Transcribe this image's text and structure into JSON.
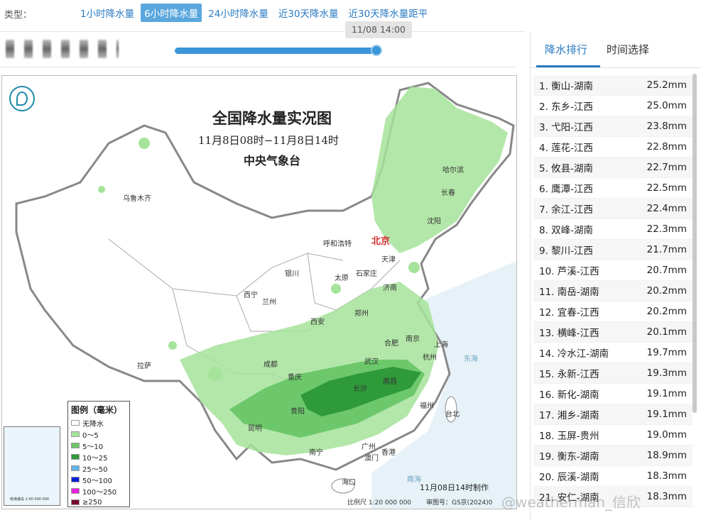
{
  "toolbar": {
    "type_label": "类型：",
    "tabs": [
      "1小时降水量",
      "6小时降水量",
      "24小时降水量",
      "近30天降水量",
      "近30天降水量距平"
    ],
    "active_tab": 1
  },
  "timeline": {
    "tooltip": "11/08 14:00",
    "progress": 1.0
  },
  "map": {
    "title": "全国降水量实况图",
    "subtitle": "11月8日08时−11月8日14时",
    "org": "中央气象台",
    "made": "11月08日14时制作",
    "scale": "比例尺 1:20 000 000",
    "approval": "审图号：GS京(2024)0",
    "capital": "北京",
    "cities": [
      "乌鲁木齐",
      "哈尔滨",
      "长春",
      "沈阳",
      "呼和浩特",
      "天津",
      "银川",
      "太原",
      "石家庄",
      "济南",
      "西宁",
      "兰州",
      "郑州",
      "西安",
      "合肥",
      "南京",
      "上海",
      "武汉",
      "杭州",
      "拉萨",
      "成都",
      "重庆",
      "南昌",
      "长沙",
      "贵阳",
      "福州",
      "台北",
      "昆明",
      "南宁",
      "广州",
      "澳门",
      "香港",
      "海口",
      "东海",
      "南海"
    ],
    "inset_caption": "南海诸岛 1:40 000 000",
    "legend": {
      "title": "图例（毫米）",
      "items": [
        {
          "label": "无降水",
          "color": "#ffffff"
        },
        {
          "label": "0～5",
          "color": "#a6e39a"
        },
        {
          "label": "5～10",
          "color": "#6cc86a"
        },
        {
          "label": "10～25",
          "color": "#2f9a3a"
        },
        {
          "label": "25～50",
          "color": "#62b2ea"
        },
        {
          "label": "50～100",
          "color": "#0b1fd6"
        },
        {
          "label": "100～250",
          "color": "#ea1fe0"
        },
        {
          "label": "≥250",
          "color": "#7a0a2c"
        }
      ]
    }
  },
  "watermark": "@weatherman_信欣",
  "panel": {
    "tab_rank": "降水排行",
    "tab_time": "时间选择",
    "ranking": [
      {
        "name": "1. 衡山-湖南",
        "value": "25.2mm"
      },
      {
        "name": "2. 东乡-江西",
        "value": "25.0mm"
      },
      {
        "name": "3. 弋阳-江西",
        "value": "23.8mm"
      },
      {
        "name": "4. 莲花-江西",
        "value": "22.8mm"
      },
      {
        "name": "5. 攸县-湖南",
        "value": "22.7mm"
      },
      {
        "name": "6. 鹰潭-江西",
        "value": "22.5mm"
      },
      {
        "name": "7. 余江-江西",
        "value": "22.4mm"
      },
      {
        "name": "8. 双峰-湖南",
        "value": "22.3mm"
      },
      {
        "name": "9. 黎川-江西",
        "value": "21.7mm"
      },
      {
        "name": "10. 芦溪-江西",
        "value": "20.7mm"
      },
      {
        "name": "11. 南岳-湖南",
        "value": "20.2mm"
      },
      {
        "name": "12. 宜春-江西",
        "value": "20.2mm"
      },
      {
        "name": "13. 横峰-江西",
        "value": "20.1mm"
      },
      {
        "name": "14. 冷水江-湖南",
        "value": "19.7mm"
      },
      {
        "name": "15. 永新-江西",
        "value": "19.3mm"
      },
      {
        "name": "16. 新化-湖南",
        "value": "19.1mm"
      },
      {
        "name": "17. 湘乡-湖南",
        "value": "19.1mm"
      },
      {
        "name": "18. 玉屏-贵州",
        "value": "19.0mm"
      },
      {
        "name": "19. 衡东-湖南",
        "value": "18.9mm"
      },
      {
        "name": "20. 辰溪-湖南",
        "value": "18.3mm"
      },
      {
        "name": "21. 安仁-湖南",
        "value": "18.3mm"
      }
    ]
  }
}
